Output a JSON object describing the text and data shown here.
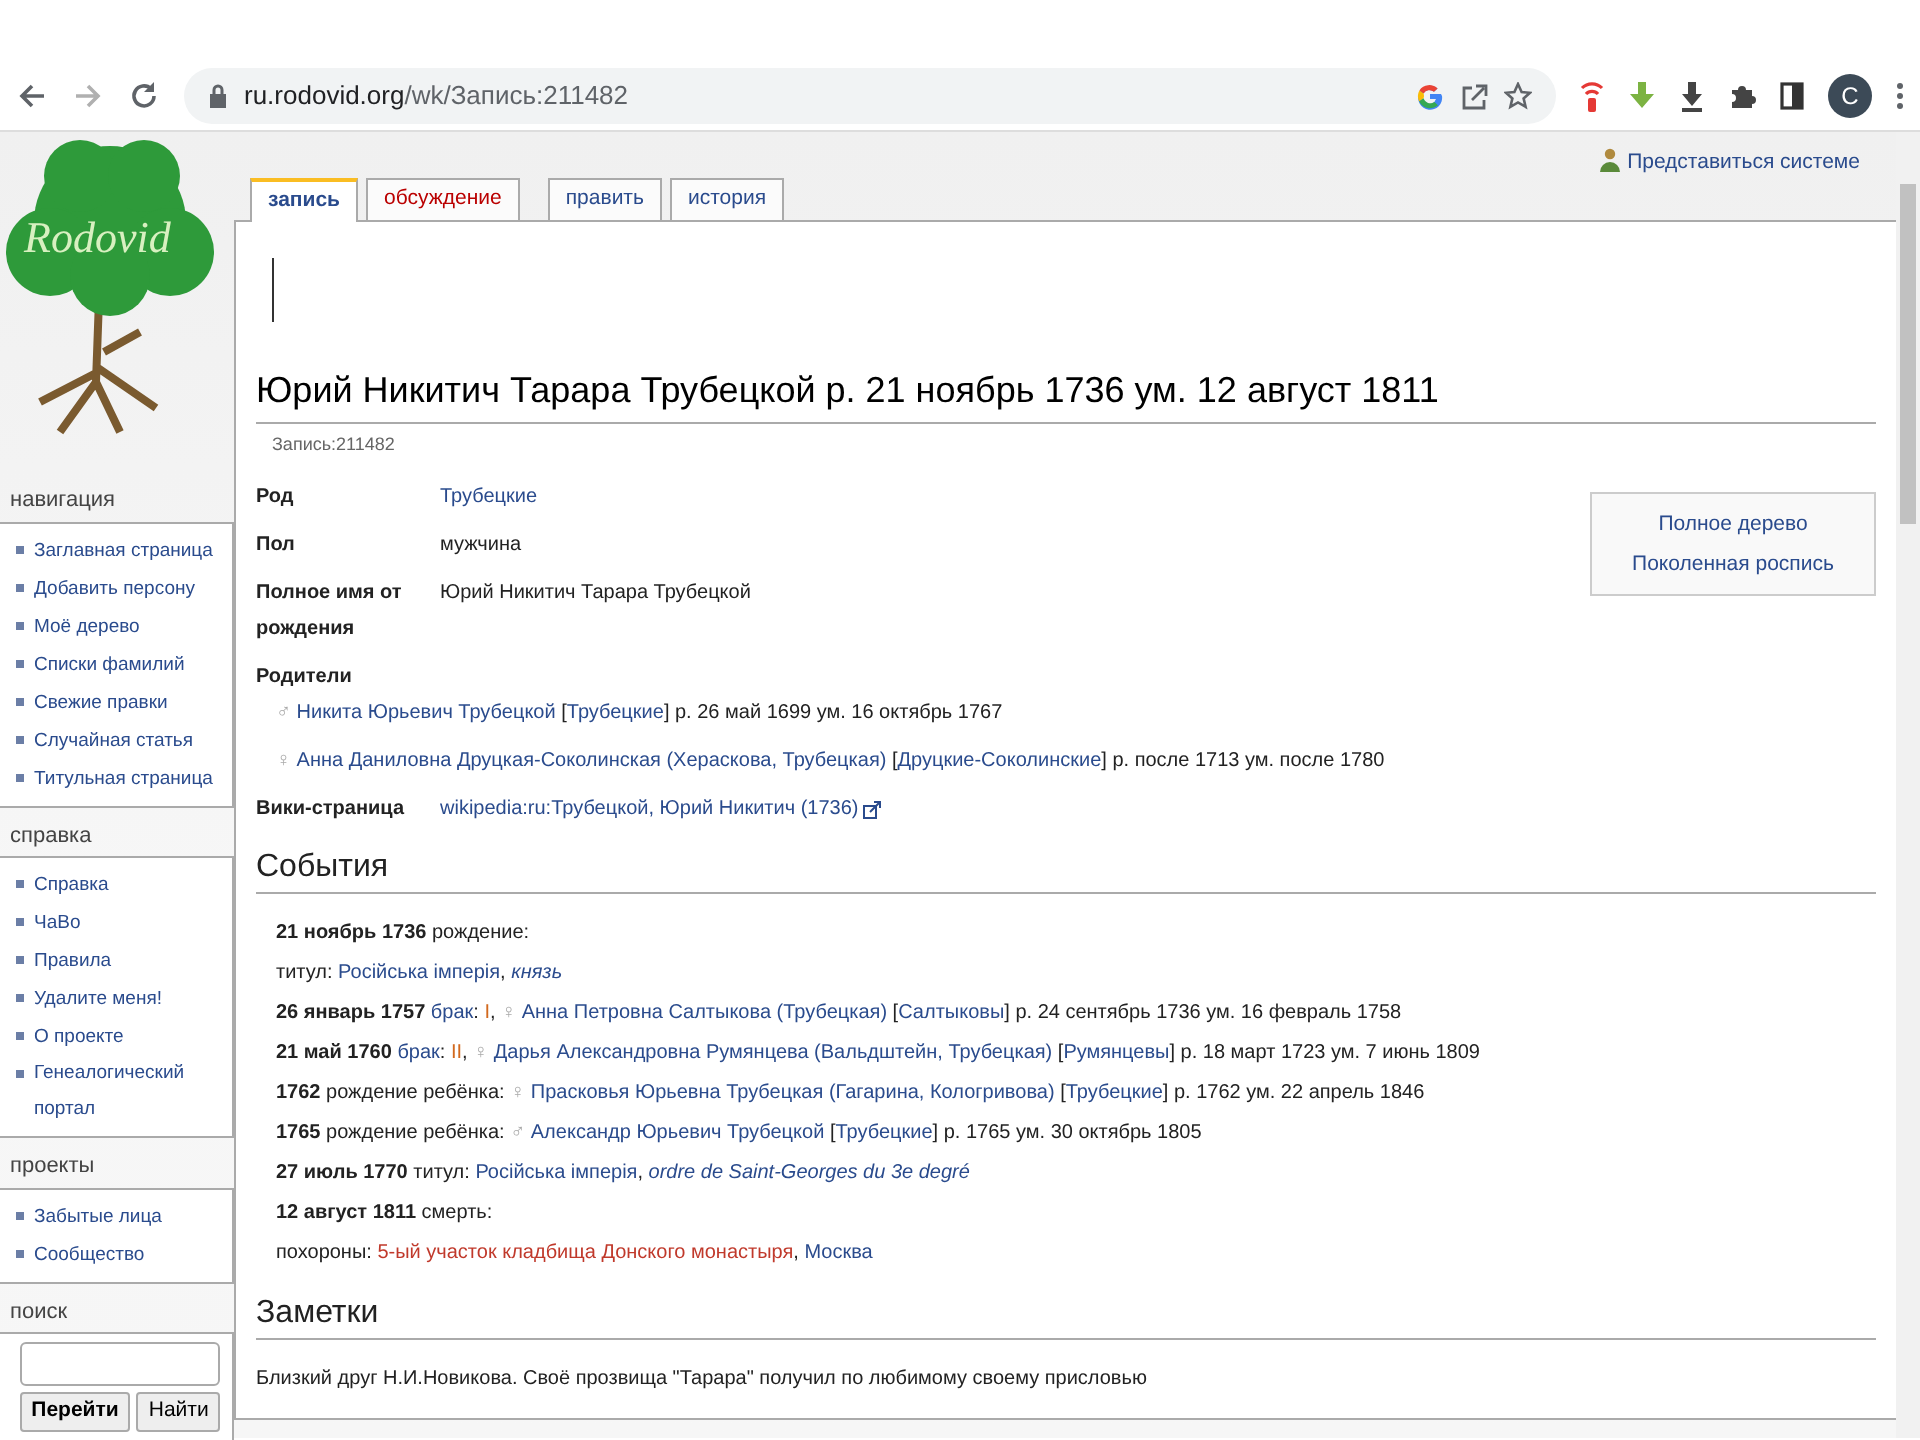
{
  "browser": {
    "url_host": "ru.rodovid.org",
    "url_path": "/wk/Запись:211482",
    "profile_initial": "C"
  },
  "user_link": "Представиться системе",
  "logo": {
    "text": "Rodovid"
  },
  "tab_groups": [
    [
      {
        "label": "запись",
        "selected": true,
        "kind": "normal"
      },
      {
        "label": "обсуждение",
        "selected": false,
        "kind": "new"
      }
    ],
    [
      {
        "label": "править",
        "selected": false,
        "kind": "normal"
      },
      {
        "label": "история",
        "selected": false,
        "kind": "normal"
      }
    ]
  ],
  "sidebar": [
    {
      "kind": "links",
      "title": "навигация",
      "items": [
        "Заглавная страница",
        "Добавить персону",
        "Моё дерево",
        "Списки фамилий",
        "Свежие правки",
        "Случайная статья",
        "Титульная страница"
      ]
    },
    {
      "kind": "links",
      "title": "справка",
      "items": [
        "Справка",
        "ЧаВо",
        "Правила",
        "Удалите меня!",
        "О проекте",
        "Генеалогический портал"
      ]
    },
    {
      "kind": "links",
      "title": "проекты",
      "items": [
        "Забытые лица",
        "Сообщество"
      ]
    },
    {
      "kind": "search",
      "title": "поиск",
      "buttons": [
        "Перейти",
        "Найти"
      ]
    }
  ],
  "page": {
    "title": "Юрий Никитич Тарара Трубецкой р. 21 ноябрь 1736 ум. 12 август 1811",
    "subtitle": "Запись:211482",
    "side_links": [
      "Полное дерево",
      "Поколенная роспись"
    ],
    "infobox": [
      {
        "label": "Род",
        "lines": [
          [
            {
              "kind": "link",
              "text": "Трубецкие"
            }
          ]
        ]
      },
      {
        "label": "Пол",
        "lines": [
          [
            {
              "kind": "plain",
              "text": "мужчина"
            }
          ]
        ]
      },
      {
        "label": "Полное имя от рождения",
        "lines": [
          [
            {
              "kind": "plain",
              "text": "Юрий Никитич Тарара Трубецкой"
            }
          ]
        ]
      },
      {
        "label": "Родители"
      },
      {
        "lines": [
          [
            {
              "kind": "symbol",
              "text": "♂ "
            },
            {
              "kind": "link",
              "text": "Никита Юрьевич Трубецкой"
            },
            {
              "kind": "plain",
              "text": " ["
            },
            {
              "kind": "link",
              "text": "Трубецкие"
            },
            {
              "kind": "plain",
              "text": "] р. 26 май 1699 ум. 16 октябрь 1767"
            }
          ],
          [
            {
              "kind": "symbol",
              "text": "♀ "
            },
            {
              "kind": "link",
              "text": "Анна Даниловна Друцкая-Соколинская (Хераскова, Трубецкая)"
            },
            {
              "kind": "plain",
              "text": " ["
            },
            {
              "kind": "link",
              "text": "Друцкие-Соколинские"
            },
            {
              "kind": "plain",
              "text": "] р. после 1713 ум. после 1780"
            }
          ]
        ]
      },
      {
        "label": "Вики-страница",
        "lines": [
          [
            {
              "kind": "external",
              "text": "wikipedia:ru:Трубецкой, Юрий Никитич (1736)"
            }
          ]
        ]
      }
    ]
  },
  "sections": [
    {
      "heading": "События",
      "lines": [
        [
          {
            "kind": "bold",
            "text": "21 ноябрь 1736"
          },
          {
            "kind": "plain",
            "text": " рождение:"
          }
        ],
        [
          {
            "kind": "plain",
            "text": "титул: "
          },
          {
            "kind": "link",
            "text": "Російська імперія"
          },
          {
            "kind": "plain",
            "text": ", "
          },
          {
            "kind": "italic_link",
            "text": "князь"
          }
        ],
        [
          {
            "kind": "bold",
            "text": "26 январь 1757 "
          },
          {
            "kind": "link",
            "text": "брак"
          },
          {
            "kind": "plain",
            "text": ": "
          },
          {
            "kind": "ordinal",
            "text": "I"
          },
          {
            "kind": "plain",
            "text": ", "
          },
          {
            "kind": "symbol",
            "text": "♀ "
          },
          {
            "kind": "link",
            "text": "Анна Петровна Салтыкова (Трубецкая)"
          },
          {
            "kind": "plain",
            "text": " ["
          },
          {
            "kind": "link",
            "text": "Салтыковы"
          },
          {
            "kind": "plain",
            "text": "] р. 24 сентябрь 1736 ум. 16 февраль 1758"
          }
        ],
        [
          {
            "kind": "bold",
            "text": "21 май 1760 "
          },
          {
            "kind": "link",
            "text": "брак"
          },
          {
            "kind": "plain",
            "text": ": "
          },
          {
            "kind": "ordinal",
            "text": "II"
          },
          {
            "kind": "plain",
            "text": ", "
          },
          {
            "kind": "symbol",
            "text": "♀ "
          },
          {
            "kind": "link",
            "text": "Дарья Александровна Румянцева (Вальдштейн, Трубецкая)"
          },
          {
            "kind": "plain",
            "text": " ["
          },
          {
            "kind": "link",
            "text": "Румянцевы"
          },
          {
            "kind": "plain",
            "text": "] р. 18 март 1723 ум. 7 июнь 1809"
          }
        ],
        [
          {
            "kind": "bold",
            "text": "1762"
          },
          {
            "kind": "plain",
            "text": " рождение ребёнка: "
          },
          {
            "kind": "symbol",
            "text": "♀ "
          },
          {
            "kind": "link",
            "text": "Прасковья Юрьевна Трубецкая (Гагарина, Кологривова)"
          },
          {
            "kind": "plain",
            "text": " ["
          },
          {
            "kind": "link",
            "text": "Трубецкие"
          },
          {
            "kind": "plain",
            "text": "] р. 1762 ум. 22 апрель 1846"
          }
        ],
        [
          {
            "kind": "bold",
            "text": "1765"
          },
          {
            "kind": "plain",
            "text": " рождение ребёнка: "
          },
          {
            "kind": "symbol",
            "text": "♂ "
          },
          {
            "kind": "link",
            "text": "Александр Юрьевич Трубецкой"
          },
          {
            "kind": "plain",
            "text": " ["
          },
          {
            "kind": "link",
            "text": "Трубецкие"
          },
          {
            "kind": "plain",
            "text": "] р. 1765 ум. 30 октябрь 1805"
          }
        ],
        [
          {
            "kind": "bold",
            "text": "27 июль 1770"
          },
          {
            "kind": "plain",
            "text": " титул: "
          },
          {
            "kind": "link",
            "text": "Російська імперія"
          },
          {
            "kind": "plain",
            "text": ", "
          },
          {
            "kind": "italic_link",
            "text": "ordre de Saint-Georges du 3e degré"
          }
        ],
        [
          {
            "kind": "bold",
            "text": "12 август 1811"
          },
          {
            "kind": "plain",
            "text": " смерть:"
          }
        ],
        [
          {
            "kind": "plain",
            "text": "похороны: "
          },
          {
            "kind": "redlink",
            "text": "5-ый участок кладбища Донского монастыря"
          },
          {
            "kind": "plain",
            "text": ", "
          },
          {
            "kind": "link",
            "text": "Москва"
          }
        ]
      ]
    },
    {
      "heading": "Заметки",
      "lines": [
        [
          {
            "kind": "plain",
            "text": "Близкий друг Н.И.Новикова. Своё прозвища \"Тарара\" получил по любимому своему присловью"
          }
        ]
      ]
    }
  ]
}
